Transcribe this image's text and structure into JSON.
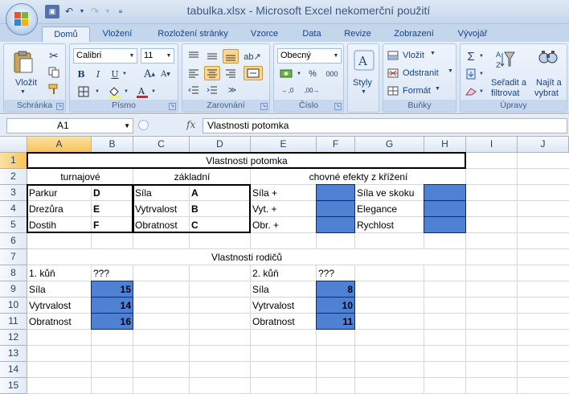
{
  "window": {
    "title": "tabulka.xlsx - Microsoft Excel nekomerční použití"
  },
  "ribbon": {
    "tabs": [
      "Domů",
      "Vložení",
      "Rozložení stránky",
      "Vzorce",
      "Data",
      "Revize",
      "Zobrazení",
      "Vývojář"
    ],
    "active_tab": "Domů",
    "groups": {
      "clipboard": {
        "label": "Schránka",
        "paste": "Vložit"
      },
      "font": {
        "label": "Písmo",
        "font_name": "Calibri",
        "font_size": "11"
      },
      "alignment": {
        "label": "Zarovnání"
      },
      "number": {
        "label": "Číslo",
        "format": "Obecný"
      },
      "styles": {
        "label": "Styly"
      },
      "cells": {
        "label": "Buňky",
        "insert": "Vložit",
        "delete": "Odstranit",
        "format": "Formát"
      },
      "editing": {
        "label": "Úpravy",
        "sort_filter_line1": "Seřadit a",
        "sort_filter_line2": "filtrovat",
        "find_line1": "Najít a",
        "find_line2": "vybrat"
      }
    }
  },
  "formula_bar": {
    "name_box": "A1",
    "fx": "fx",
    "content": "Vlastnosti potomka"
  },
  "sheet": {
    "columns": [
      "A",
      "B",
      "C",
      "D",
      "E",
      "F",
      "G",
      "H",
      "I",
      "J"
    ],
    "rows": [
      "1",
      "2",
      "3",
      "4",
      "5",
      "6",
      "7",
      "8",
      "9",
      "10",
      "11",
      "12",
      "13",
      "14",
      "15"
    ],
    "cells": {
      "A1": "Vlastnosti potomka",
      "A2": "turnajové",
      "C2": "základní",
      "E2": "chovné efekty z křížení",
      "A3": "Parkur",
      "B3": "D",
      "A4": "Drezůra",
      "B4": "E",
      "A5": "Dostih",
      "B5": "F",
      "C3": "Síla",
      "D3": "A",
      "C4": "Vytrvalost",
      "D4": "B",
      "C5": "Obratnost",
      "D5": "C",
      "E3": "Síla +",
      "E4": "Vyt. +",
      "E5": "Obr. +",
      "G3": "Síla ve skoku",
      "G4": "Elegance",
      "G5": "Rychlost",
      "A7": "Vlastnosti rodičů",
      "A8": "1. kůň",
      "B8": "???",
      "E8": "2. kůň",
      "F8": "???",
      "A9": "Síla",
      "B9": "15",
      "A10": "Vytrvalost",
      "B10": "14",
      "A11": "Obratnost",
      "B11": "16",
      "E9": "Síla",
      "F9": "8",
      "E10": "Vytrvalost",
      "F10": "10",
      "E11": "Obratnost",
      "F11": "11"
    },
    "fill_color": "#4f81d2"
  }
}
